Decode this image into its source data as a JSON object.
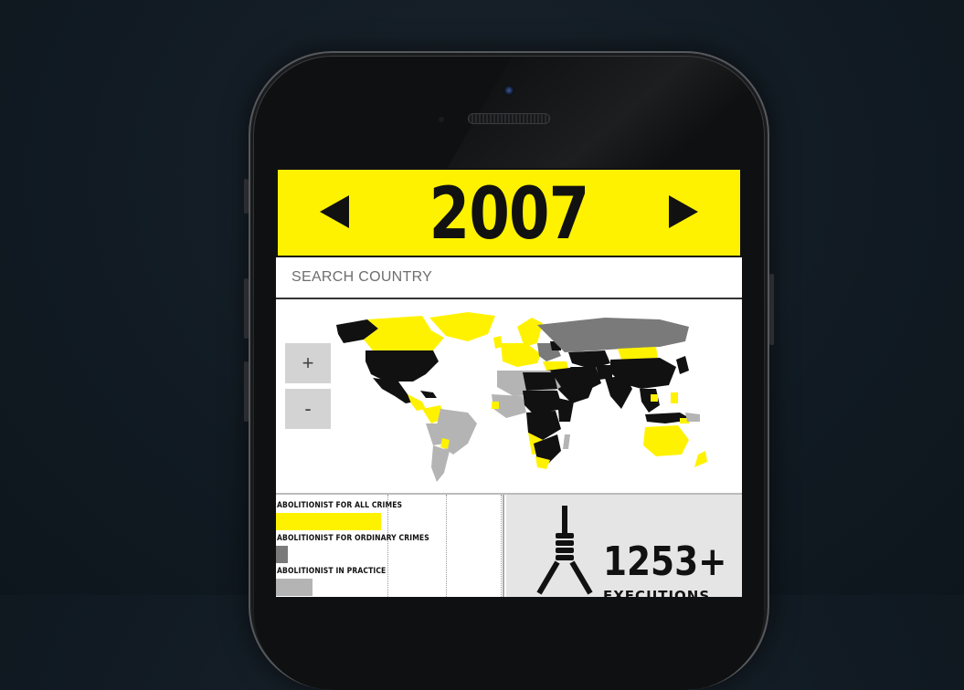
{
  "colors": {
    "accent_yellow": "#fff200",
    "abolitionist_all": "#fff200",
    "abolitionist_ordinary": "#7a7a7a",
    "abolitionist_practice": "#b4b4b4",
    "retentionist": "#000000"
  },
  "header": {
    "year": "2007",
    "prev_icon": "triangle-left-icon",
    "next_icon": "triangle-right-icon"
  },
  "search": {
    "placeholder": "SEARCH COUNTRY"
  },
  "map": {
    "zoom_in_label": "+",
    "zoom_out_label": "-"
  },
  "legend": {
    "items": [
      {
        "label": "ABOLITIONIST FOR ALL CRIMES",
        "fraction": 0.46
      },
      {
        "label": "ABOLITIONIST FOR ORDINARY CRIMES",
        "fraction": 0.05
      },
      {
        "label": "ABOLITIONIST IN PRACTICE",
        "fraction": 0.16
      }
    ]
  },
  "stats": {
    "executions_count": "1253+",
    "executions_label": "EXECUTIONS",
    "icon": "noose-icon"
  }
}
